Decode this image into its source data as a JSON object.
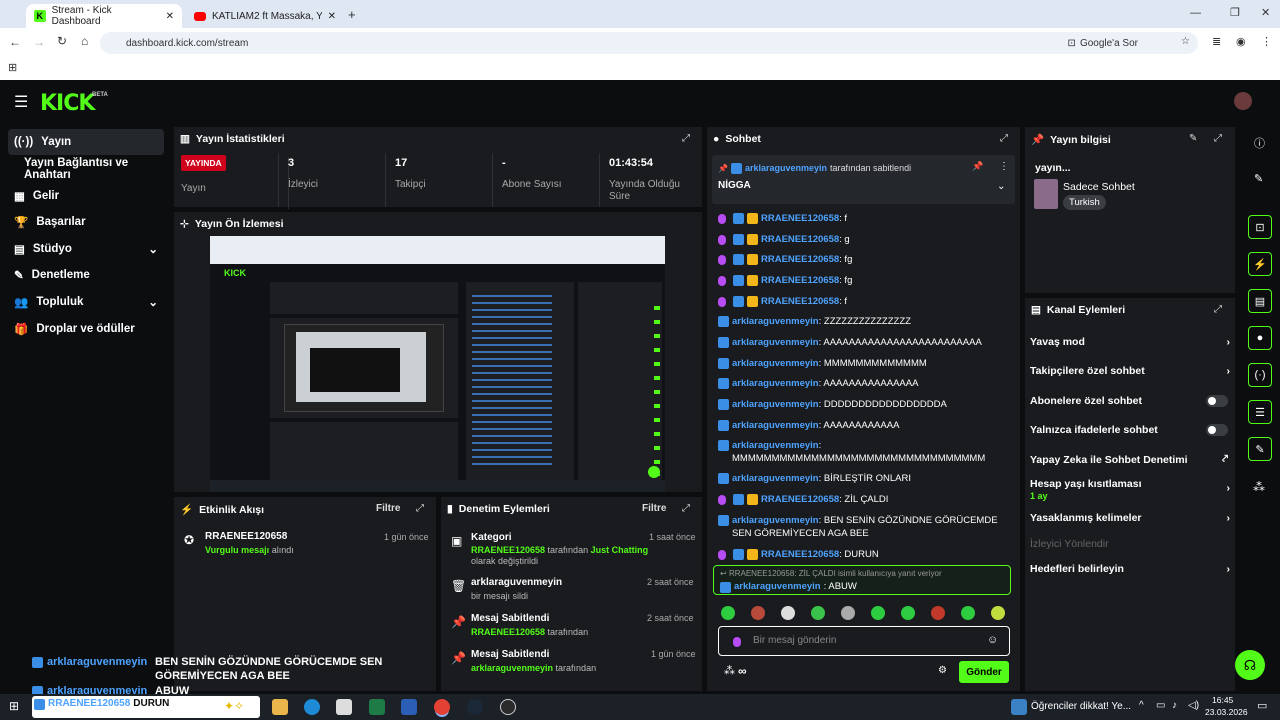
{
  "browser": {
    "tabs": [
      {
        "label": "Stream - Kick Dashboard"
      },
      {
        "label": "KATLİAM2 ft Massaka, Yener Ce"
      }
    ],
    "url": "dashboard.kick.com/stream",
    "google_lens": "Google'a Sor"
  },
  "brand": {
    "logo": "KICK",
    "beta": "BETA"
  },
  "sidebar": {
    "items": [
      {
        "label": "Yayın"
      },
      {
        "label": "Yayın Bağlantısı ve Anahtarı"
      },
      {
        "label": "Gelir"
      },
      {
        "label": "Başarılar"
      },
      {
        "label": "Stüdyo"
      },
      {
        "label": "Denetleme"
      },
      {
        "label": "Topluluk"
      },
      {
        "label": "Droplar ve ödüller"
      }
    ]
  },
  "stats": {
    "title": "Yayın İstatistikleri",
    "live": "YAYINDA",
    "live_label": "Yayın",
    "items": [
      {
        "value": "3",
        "label": "İzleyici"
      },
      {
        "value": "17",
        "label": "Takipçi"
      },
      {
        "value": "-",
        "label": "Abone Sayısı"
      },
      {
        "value": "01:43:54",
        "label": "Yayında Olduğu Süre"
      }
    ]
  },
  "preview": {
    "title": "Yayın Ön İzlemesi"
  },
  "activity": {
    "title": "Etkinlik Akışı",
    "filter": "Filtre",
    "items": [
      {
        "user": "RRAENEE120658",
        "text_a": "Vurgulu mesajı",
        "text_b": " alındı",
        "time": "1 gün önce"
      }
    ]
  },
  "moderation": {
    "title": "Denetim Eylemleri",
    "filter": "Filtre",
    "items": [
      {
        "title": "Kategori",
        "time": "1 saat önce",
        "user": "RRAENEE120658",
        "mid": " tarafından ",
        "hl": "Just Chatting",
        "tail": " olarak değiştirildi"
      },
      {
        "title": "arklaraguvenmeyin",
        "time": "2 saat önce",
        "sub": "bir mesajı sildi"
      },
      {
        "title": "Mesaj Sabitlendi",
        "time": "2 saat önce",
        "user": "RRAENEE120658",
        "tail": " tarafından"
      },
      {
        "title": "Mesaj Sabitlendi",
        "time": "1 gün önce",
        "user": "arklaraguvenmeyin",
        "tail": " tarafından"
      }
    ]
  },
  "chat": {
    "title": "Sohbet",
    "pinned": {
      "user": "arklaraguvenmeyin",
      "suffix": " tarafından sabitlendi",
      "message": "NİGGA"
    },
    "messages": [
      {
        "user": "RRAENEE120658",
        "text": ": f",
        "mic": true
      },
      {
        "user": "RRAENEE120658",
        "text": ": g",
        "mic": true
      },
      {
        "user": "RRAENEE120658",
        "text": ": fg",
        "mic": true
      },
      {
        "user": "RRAENEE120658",
        "text": ": fg",
        "mic": true
      },
      {
        "user": "RRAENEE120658",
        "text": ": f",
        "mic": true
      },
      {
        "user": "arklaraguvenmeyin",
        "text": ": ZZZZZZZZZZZZZZZ",
        "mic": false
      },
      {
        "user": "arklaraguvenmeyin",
        "text": ": AAAAAAAAAAAAAAAAAAAAAAAAA",
        "mic": false
      },
      {
        "user": "arklaraguvenmeyin",
        "text": ": MMMMMMMMMMMMM",
        "mic": false
      },
      {
        "user": "arklaraguvenmeyin",
        "text": ": AAAAAAAAAAAAAAA",
        "mic": false
      },
      {
        "user": "arklaraguvenmeyin",
        "text": ": DDDDDDDDDDDDDDDDDA",
        "mic": false
      },
      {
        "user": "arklaraguvenmeyin",
        "text": ": AAAAAAAAAAAA",
        "mic": false
      },
      {
        "user": "arklaraguvenmeyin",
        "text": ": MMMMMMMMMMMMMMMMMMMMMMMMMMMMMMMM",
        "mic": false
      },
      {
        "user": "arklaraguvenmeyin",
        "text": ": BİRLEŞTİR ONLARI",
        "mic": false
      },
      {
        "user": "RRAENEE120658",
        "text": ": ZİL ÇALDI",
        "mic": true
      },
      {
        "user": "arklaraguvenmeyin",
        "text": ": BEN SENİN GÖZÜNDNE GÖRÜCEMDE SEN GÖREMİYECEN AGA BEE",
        "mic": false
      },
      {
        "user": "RRAENEE120658",
        "text": ": DURUN",
        "mic": true
      }
    ],
    "reply": {
      "context": "RRAENEE120658: ZİL ÇALDI isimli kullanıcıya yanıt veriyor",
      "user": "arklaraguvenmeyin",
      "text": ": ABUW"
    },
    "input_placeholder": "Bir mesaj gönderin",
    "send": "Gönder",
    "points": "∞"
  },
  "info": {
    "title": "Yayın bilgisi",
    "stream_title": "yayın...",
    "category": "Sadece Sohbet",
    "language": "Turkish"
  },
  "channel_actions": {
    "title": "Kanal Eylemleri",
    "items": [
      {
        "label": "Yavaş mod"
      },
      {
        "label": "Takipçilere özel sohbet"
      },
      {
        "label": "Abonelere özel sohbet"
      },
      {
        "label": "Yalnızca ifadelerle sohbet"
      },
      {
        "label": "Yapay Zeka ile Sohbet Denetimi"
      },
      {
        "label": "Hesap yaşı kısıtlaması",
        "sub": "1 ay"
      },
      {
        "label": "Yasaklanmış kelimeler"
      },
      {
        "label": "İzleyici Yönlendir"
      },
      {
        "label": "Hedefleri belirleyin"
      }
    ]
  },
  "overlay": {
    "line1_user": "arklaraguvenmeyin",
    "line1_text": "BEN SENİN GÖZÜNDNE GÖRÜCEMDE SEN",
    "line2_text": "GÖREMİYECEN AGA BEE",
    "line3_user": "arklaraguvenmeyin",
    "line3_text": "ABUW",
    "line4_user": "RRAENEE120658",
    "line4_text": "DURUN"
  },
  "taskbar": {
    "notification": "Öğrenciler dikkat! Ye...",
    "time": "16:45",
    "date": "23.03.2026"
  },
  "colors": {
    "accent": "#53fc18",
    "live": "#d0021b",
    "username": "#4ea3ff",
    "panel": "#191b1f"
  }
}
